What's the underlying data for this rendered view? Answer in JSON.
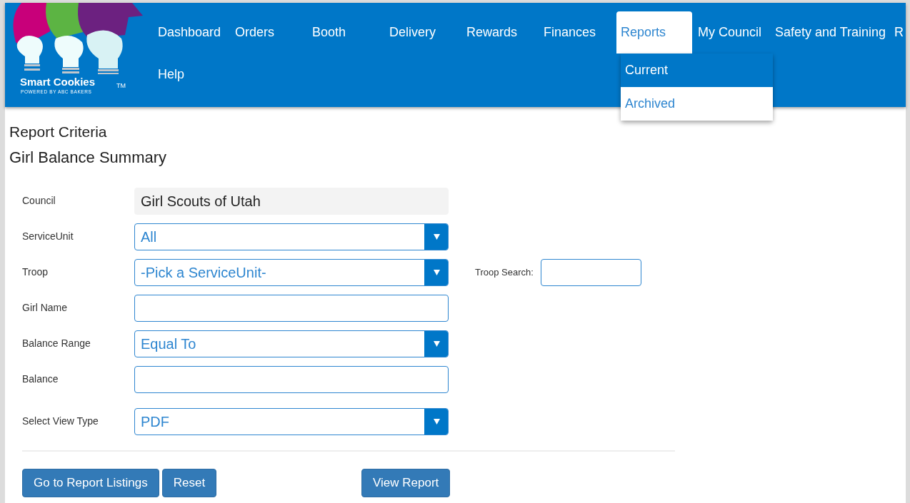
{
  "logo": {
    "name": "Smart Cookies",
    "trademark": "TM",
    "tagline": "POWERED BY ABC BAKERS"
  },
  "menu": {
    "rows": [
      [
        {
          "label": "Dashboard",
          "selected": false
        },
        {
          "label": "Orders",
          "selected": false
        },
        {
          "label": "Booth",
          "selected": false
        },
        {
          "label": "Delivery",
          "selected": false
        },
        {
          "label": "Rewards",
          "selected": false
        },
        {
          "label": "Finances",
          "selected": false
        },
        {
          "label": "Reports",
          "selected": true,
          "dropdown": [
            {
              "label": "Current",
              "selected": true
            },
            {
              "label": "Archived",
              "selected": false
            }
          ]
        },
        {
          "label": "My Council",
          "selected": false
        },
        {
          "label": "Safety and Training",
          "selected": false
        },
        {
          "label": "R",
          "selected": false
        }
      ],
      [
        {
          "label": "Help",
          "selected": false
        }
      ]
    ]
  },
  "page": {
    "title": "Report Criteria",
    "subtitle": "Girl Balance Summary"
  },
  "form": {
    "fields": [
      {
        "label": "Council",
        "kind": "readonly",
        "value": "Girl Scouts of Utah"
      },
      {
        "label": "ServiceUnit",
        "kind": "select",
        "value": "All"
      },
      {
        "label": "Troop",
        "kind": "select",
        "value": "-Pick a ServiceUnit-",
        "search": {
          "label": "Troop Search:"
        }
      },
      {
        "label": "Girl Name",
        "kind": "text"
      },
      {
        "label": "Balance Range",
        "kind": "select",
        "value": "Equal To"
      },
      {
        "label": "Balance",
        "kind": "text"
      },
      {
        "label": "Select View Type",
        "kind": "select",
        "value": "PDF"
      }
    ]
  },
  "buttons": {
    "left": [
      "Go to Report Listings",
      "Reset"
    ],
    "right": [
      "View Report"
    ]
  }
}
